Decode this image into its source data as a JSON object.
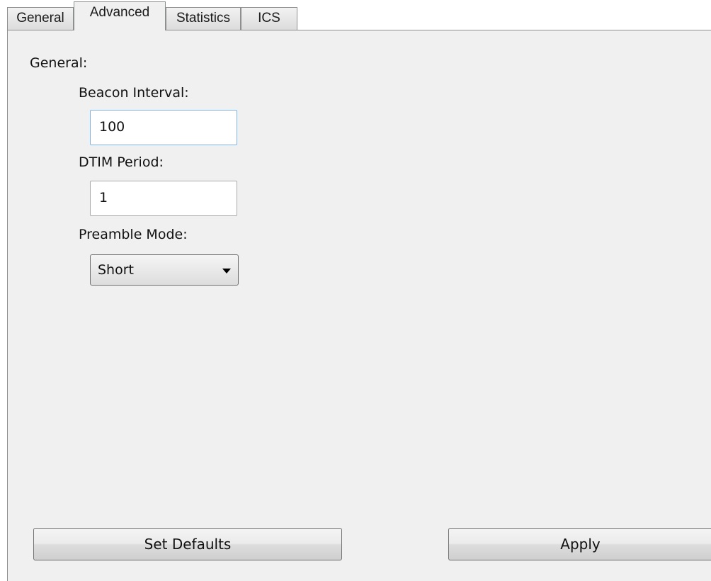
{
  "tabs": [
    {
      "label": "General",
      "active": false
    },
    {
      "label": "Advanced",
      "active": true
    },
    {
      "label": "Statistics",
      "active": false
    },
    {
      "label": "ICS",
      "active": false
    }
  ],
  "section": {
    "label": "General:"
  },
  "fields": {
    "beacon_interval": {
      "label": "Beacon Interval:",
      "value": "100"
    },
    "dtim_period": {
      "label": "DTIM Period:",
      "value": "1"
    },
    "preamble_mode": {
      "label": "Preamble Mode:",
      "selected": "Short"
    }
  },
  "buttons": {
    "set_defaults": "Set Defaults",
    "apply": "Apply"
  }
}
